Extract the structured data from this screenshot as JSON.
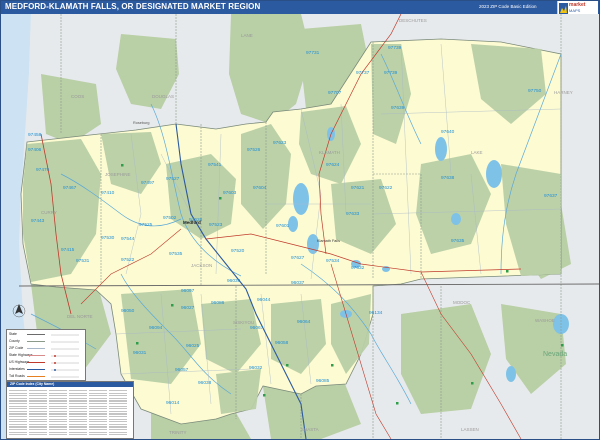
{
  "header": {
    "title": "MEDFORD-KLAMATH FALLS, OR DESIGNATED MARKET REGION",
    "edition": "2023 ZIP Code Basic Edition",
    "brand_line1": "market",
    "brand_line2": "MAPS"
  },
  "colors": {
    "title_bar": "#2c5aa0",
    "dma_fill": "#fdfbd2",
    "forest": "#b9cfa6",
    "outside": "#e9ecef",
    "ocean": "#cde3f3",
    "water": "#7fc2e8",
    "zip_label": "#1f8fd6",
    "boundary": "#7a8a7a"
  },
  "map": {
    "zip_labels": [
      "97731",
      "97739",
      "97737",
      "97707",
      "97739",
      "97750",
      "97639",
      "97640",
      "97458",
      "97406",
      "97476",
      "97467",
      "97410",
      "97443",
      "97497",
      "97541",
      "97527",
      "97526",
      "97623",
      "97624",
      "97621",
      "97622",
      "97604",
      "97603",
      "97626",
      "97502",
      "97523",
      "97525",
      "97544",
      "97530",
      "97535",
      "97520",
      "97601",
      "97627",
      "97633",
      "97632",
      "97415",
      "97531",
      "97522",
      "97534",
      "97638",
      "97635",
      "97637",
      "96037",
      "96097",
      "96039",
      "96044",
      "96027",
      "96050",
      "96134",
      "96064",
      "96094",
      "96067",
      "96058",
      "96025",
      "96057",
      "96032",
      "96038",
      "96085",
      "96014",
      "96031",
      "96086"
    ],
    "city_labels": [
      "Medford",
      "Nevada",
      "Roseburg",
      "Klamath Falls"
    ],
    "county_labels": [
      "LANE",
      "DESCHUTES",
      "HARNEY",
      "COOS",
      "DOUGLAS",
      "JOSEPHINE",
      "JACKSON",
      "KLAMATH",
      "LAKE",
      "DEL NORTE",
      "CURRY",
      "SISKIYOU",
      "MODOC",
      "WASHOE",
      "SHASTA",
      "LASSEN",
      "HUMBOLDT",
      "TRINITY"
    ]
  },
  "legend": {
    "rows": [
      "State",
      "County",
      "ZIP Code",
      "State Highways",
      "US Highways",
      "Interstates",
      "Toll Roads"
    ]
  },
  "index": {
    "title": "ZIP Code Index (City Name)"
  }
}
